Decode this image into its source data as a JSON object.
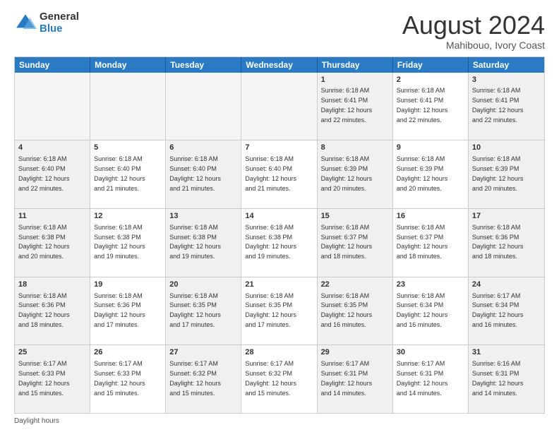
{
  "logo": {
    "general": "General",
    "blue": "Blue"
  },
  "title": "August 2024",
  "subtitle": "Mahibouo, Ivory Coast",
  "days": [
    "Sunday",
    "Monday",
    "Tuesday",
    "Wednesday",
    "Thursday",
    "Friday",
    "Saturday"
  ],
  "footer": "Daylight hours",
  "weeks": [
    [
      {
        "day": "",
        "text": "",
        "empty": true
      },
      {
        "day": "",
        "text": "",
        "empty": true
      },
      {
        "day": "",
        "text": "",
        "empty": true
      },
      {
        "day": "",
        "text": "",
        "empty": true
      },
      {
        "day": "1",
        "text": "Sunrise: 6:18 AM\nSunset: 6:41 PM\nDaylight: 12 hours\nand 22 minutes.",
        "empty": false
      },
      {
        "day": "2",
        "text": "Sunrise: 6:18 AM\nSunset: 6:41 PM\nDaylight: 12 hours\nand 22 minutes.",
        "empty": false
      },
      {
        "day": "3",
        "text": "Sunrise: 6:18 AM\nSunset: 6:41 PM\nDaylight: 12 hours\nand 22 minutes.",
        "empty": false
      }
    ],
    [
      {
        "day": "4",
        "text": "Sunrise: 6:18 AM\nSunset: 6:40 PM\nDaylight: 12 hours\nand 22 minutes.",
        "empty": false
      },
      {
        "day": "5",
        "text": "Sunrise: 6:18 AM\nSunset: 6:40 PM\nDaylight: 12 hours\nand 21 minutes.",
        "empty": false
      },
      {
        "day": "6",
        "text": "Sunrise: 6:18 AM\nSunset: 6:40 PM\nDaylight: 12 hours\nand 21 minutes.",
        "empty": false
      },
      {
        "day": "7",
        "text": "Sunrise: 6:18 AM\nSunset: 6:40 PM\nDaylight: 12 hours\nand 21 minutes.",
        "empty": false
      },
      {
        "day": "8",
        "text": "Sunrise: 6:18 AM\nSunset: 6:39 PM\nDaylight: 12 hours\nand 20 minutes.",
        "empty": false
      },
      {
        "day": "9",
        "text": "Sunrise: 6:18 AM\nSunset: 6:39 PM\nDaylight: 12 hours\nand 20 minutes.",
        "empty": false
      },
      {
        "day": "10",
        "text": "Sunrise: 6:18 AM\nSunset: 6:39 PM\nDaylight: 12 hours\nand 20 minutes.",
        "empty": false
      }
    ],
    [
      {
        "day": "11",
        "text": "Sunrise: 6:18 AM\nSunset: 6:38 PM\nDaylight: 12 hours\nand 20 minutes.",
        "empty": false
      },
      {
        "day": "12",
        "text": "Sunrise: 6:18 AM\nSunset: 6:38 PM\nDaylight: 12 hours\nand 19 minutes.",
        "empty": false
      },
      {
        "day": "13",
        "text": "Sunrise: 6:18 AM\nSunset: 6:38 PM\nDaylight: 12 hours\nand 19 minutes.",
        "empty": false
      },
      {
        "day": "14",
        "text": "Sunrise: 6:18 AM\nSunset: 6:38 PM\nDaylight: 12 hours\nand 19 minutes.",
        "empty": false
      },
      {
        "day": "15",
        "text": "Sunrise: 6:18 AM\nSunset: 6:37 PM\nDaylight: 12 hours\nand 18 minutes.",
        "empty": false
      },
      {
        "day": "16",
        "text": "Sunrise: 6:18 AM\nSunset: 6:37 PM\nDaylight: 12 hours\nand 18 minutes.",
        "empty": false
      },
      {
        "day": "17",
        "text": "Sunrise: 6:18 AM\nSunset: 6:36 PM\nDaylight: 12 hours\nand 18 minutes.",
        "empty": false
      }
    ],
    [
      {
        "day": "18",
        "text": "Sunrise: 6:18 AM\nSunset: 6:36 PM\nDaylight: 12 hours\nand 18 minutes.",
        "empty": false
      },
      {
        "day": "19",
        "text": "Sunrise: 6:18 AM\nSunset: 6:36 PM\nDaylight: 12 hours\nand 17 minutes.",
        "empty": false
      },
      {
        "day": "20",
        "text": "Sunrise: 6:18 AM\nSunset: 6:35 PM\nDaylight: 12 hours\nand 17 minutes.",
        "empty": false
      },
      {
        "day": "21",
        "text": "Sunrise: 6:18 AM\nSunset: 6:35 PM\nDaylight: 12 hours\nand 17 minutes.",
        "empty": false
      },
      {
        "day": "22",
        "text": "Sunrise: 6:18 AM\nSunset: 6:35 PM\nDaylight: 12 hours\nand 16 minutes.",
        "empty": false
      },
      {
        "day": "23",
        "text": "Sunrise: 6:18 AM\nSunset: 6:34 PM\nDaylight: 12 hours\nand 16 minutes.",
        "empty": false
      },
      {
        "day": "24",
        "text": "Sunrise: 6:17 AM\nSunset: 6:34 PM\nDaylight: 12 hours\nand 16 minutes.",
        "empty": false
      }
    ],
    [
      {
        "day": "25",
        "text": "Sunrise: 6:17 AM\nSunset: 6:33 PM\nDaylight: 12 hours\nand 15 minutes.",
        "empty": false
      },
      {
        "day": "26",
        "text": "Sunrise: 6:17 AM\nSunset: 6:33 PM\nDaylight: 12 hours\nand 15 minutes.",
        "empty": false
      },
      {
        "day": "27",
        "text": "Sunrise: 6:17 AM\nSunset: 6:32 PM\nDaylight: 12 hours\nand 15 minutes.",
        "empty": false
      },
      {
        "day": "28",
        "text": "Sunrise: 6:17 AM\nSunset: 6:32 PM\nDaylight: 12 hours\nand 15 minutes.",
        "empty": false
      },
      {
        "day": "29",
        "text": "Sunrise: 6:17 AM\nSunset: 6:31 PM\nDaylight: 12 hours\nand 14 minutes.",
        "empty": false
      },
      {
        "day": "30",
        "text": "Sunrise: 6:17 AM\nSunset: 6:31 PM\nDaylight: 12 hours\nand 14 minutes.",
        "empty": false
      },
      {
        "day": "31",
        "text": "Sunrise: 6:16 AM\nSunset: 6:31 PM\nDaylight: 12 hours\nand 14 minutes.",
        "empty": false
      }
    ]
  ]
}
